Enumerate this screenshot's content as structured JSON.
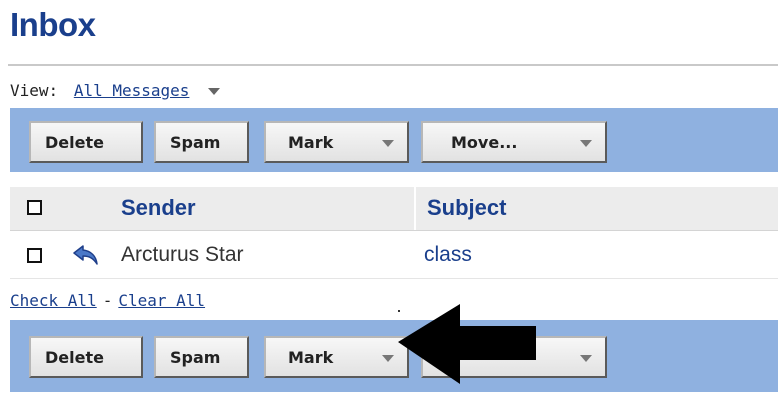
{
  "page_title": "Inbox",
  "view": {
    "label": "View:",
    "value": "All Messages"
  },
  "toolbar": {
    "delete_label": "Delete",
    "spam_label": "Spam",
    "mark_label": "Mark",
    "move_label": "Move..."
  },
  "table": {
    "headers": {
      "sender": "Sender",
      "subject": "Subject"
    },
    "rows": [
      {
        "sender": "Arcturus Star",
        "subject": "class"
      }
    ]
  },
  "selection": {
    "check_all": "Check All",
    "separator": "-",
    "clear_all": "Clear All"
  },
  "colors": {
    "accent": "#1a3f8c",
    "toolbar_bg": "#8fb1e0",
    "header_bg": "#ececec"
  },
  "icons": {
    "reply": "reply-arrow-icon",
    "dropdown": "triangle-down-icon",
    "annotation": "black-arrow-icon"
  }
}
